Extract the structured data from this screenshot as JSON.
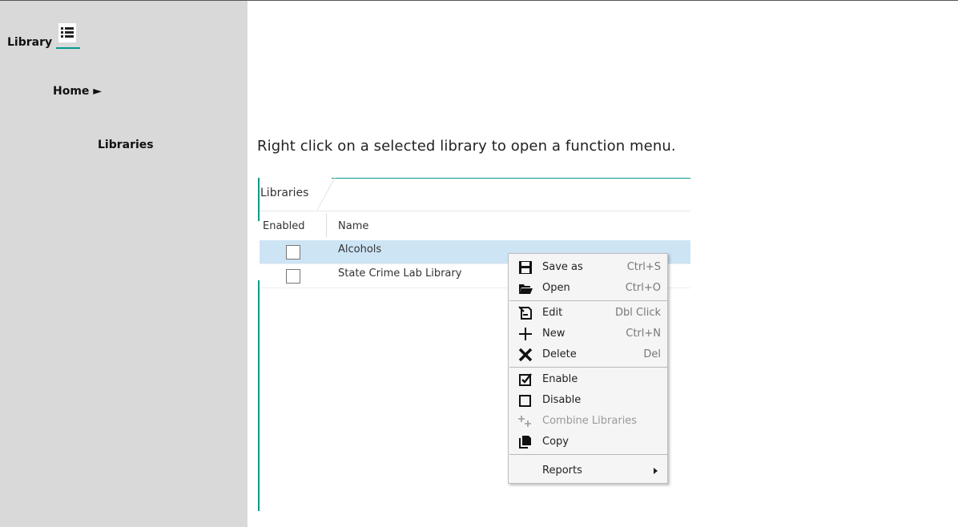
{
  "sidebar": {
    "library_label": "Library",
    "home_label": "Home ►",
    "libraries_label": "Libraries"
  },
  "main": {
    "instruction": "Right click on a selected library to open a function menu."
  },
  "panel": {
    "tab_label": "Libraries",
    "columns": [
      "Enabled",
      "Name"
    ],
    "rows": [
      {
        "enabled": false,
        "name": "Alcohols",
        "selected": true
      },
      {
        "enabled": false,
        "name": "State Crime Lab Library",
        "selected": false
      }
    ]
  },
  "context_menu": {
    "items": [
      {
        "icon": "save-icon",
        "label": "Save as",
        "shortcut": "Ctrl+S"
      },
      {
        "icon": "open-folder-icon",
        "label": "Open",
        "shortcut": "Ctrl+O"
      },
      {
        "icon": "edit-icon",
        "label": "Edit",
        "shortcut": "Dbl Click"
      },
      {
        "icon": "plus-icon",
        "label": "New",
        "shortcut": "Ctrl+N"
      },
      {
        "icon": "x-icon",
        "label": "Delete",
        "shortcut": "Del"
      },
      {
        "icon": "checked-box-icon",
        "label": "Enable",
        "shortcut": ""
      },
      {
        "icon": "empty-box-icon",
        "label": "Disable",
        "shortcut": ""
      },
      {
        "icon": "combine-icon",
        "label": "Combine Libraries",
        "shortcut": "",
        "disabled": true
      },
      {
        "icon": "copy-icon",
        "label": "Copy",
        "shortcut": ""
      },
      {
        "icon": "",
        "label": "Reports",
        "shortcut": "",
        "submenu": true
      }
    ]
  },
  "colors": {
    "accent": "#009a8c",
    "sidebar_bg": "#d9d9d9",
    "selection": "#cde4f5",
    "menu_bg": "#f5f5f5"
  }
}
